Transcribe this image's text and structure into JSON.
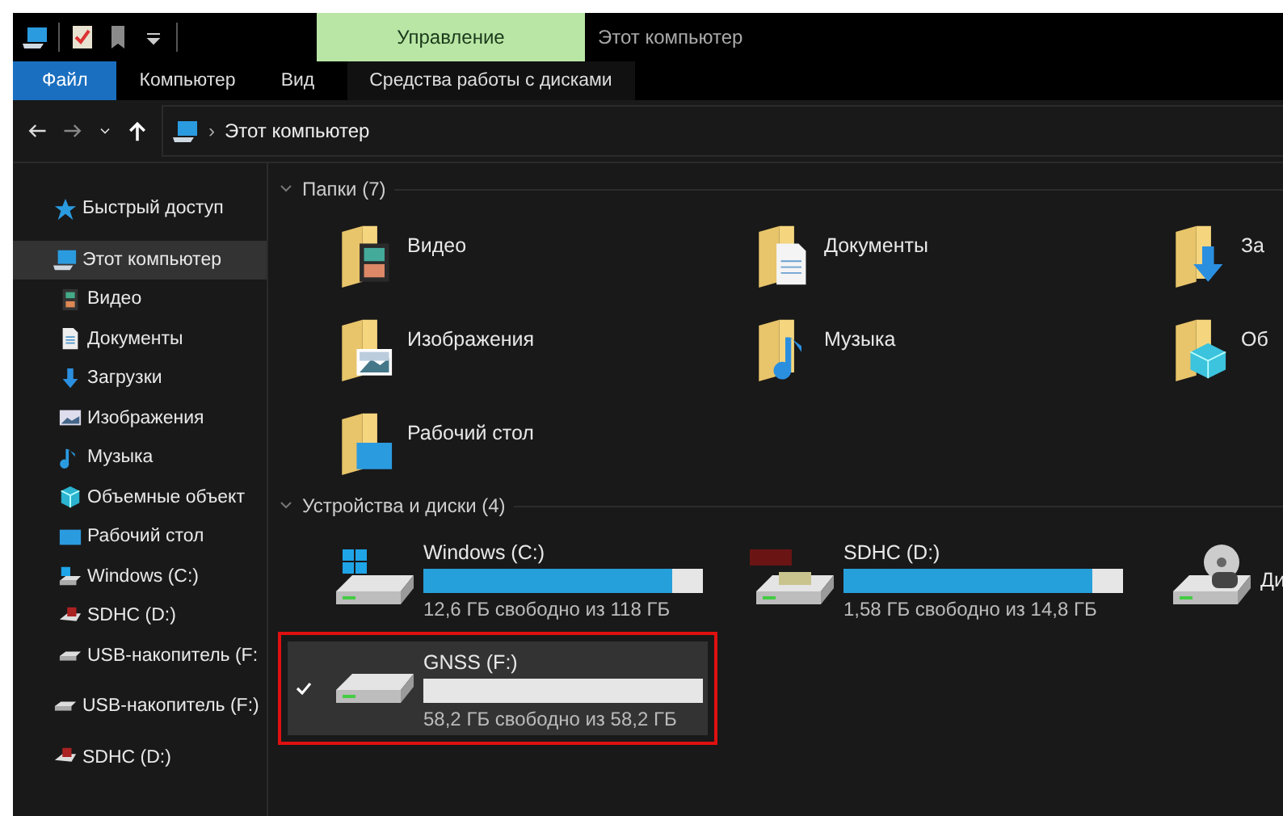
{
  "title_bar": {
    "context_tab": "Управление",
    "title": "Этот компьютер"
  },
  "ribbon_tabs": [
    {
      "label": "Файл",
      "selected": true,
      "contextual": false
    },
    {
      "label": "Компьютер",
      "selected": false,
      "contextual": false
    },
    {
      "label": "Вид",
      "selected": false,
      "contextual": false
    },
    {
      "label": "Средства работы с дисками",
      "selected": false,
      "contextual": true
    }
  ],
  "address_bar": {
    "separator": "›",
    "path": "Этот компьютер"
  },
  "sidebar": {
    "items": [
      {
        "label": "Быстрый доступ",
        "kind": "star",
        "selected": false
      },
      {
        "label": "Этот компьютер",
        "kind": "pc",
        "selected": true,
        "children": [
          {
            "label": "Видео",
            "kind": "video",
            "selected": false
          },
          {
            "label": "Документы",
            "kind": "docs",
            "selected": false
          },
          {
            "label": "Загрузки",
            "kind": "download",
            "selected": false
          },
          {
            "label": "Изображения",
            "kind": "pictures",
            "selected": false
          },
          {
            "label": "Музыка",
            "kind": "music",
            "selected": false
          },
          {
            "label": "Объемные объект",
            "kind": "cube",
            "selected": false
          },
          {
            "label": "Рабочий стол",
            "kind": "desktop",
            "selected": false
          },
          {
            "label": "Windows (C:)",
            "kind": "windows",
            "selected": false
          },
          {
            "label": "SDHC (D:)",
            "kind": "sd",
            "selected": false
          },
          {
            "label": "USB-накопитель (F:",
            "kind": "usb",
            "selected": false
          }
        ]
      },
      {
        "label": "USB-накопитель (F:)",
        "kind": "usb",
        "selected": false
      },
      {
        "label": "SDHC (D:)",
        "kind": "sd",
        "selected": false
      }
    ]
  },
  "folders": {
    "header": "Папки (7)",
    "items": [
      {
        "label": "Видео",
        "kind": "video"
      },
      {
        "label": "Документы",
        "kind": "docs"
      },
      {
        "label": "За",
        "kind": "download"
      },
      {
        "label": "Изображения",
        "kind": "pictures"
      },
      {
        "label": "Музыка",
        "kind": "music"
      },
      {
        "label": "Об",
        "kind": "cube"
      },
      {
        "label": "Рабочий стол",
        "kind": "desktop"
      }
    ]
  },
  "drives": {
    "header": "Устройства и диски (4)",
    "items": [
      {
        "label": "Windows (C:)",
        "kind": "windows",
        "level": 0.89,
        "free": "12,6 ГБ свободно из 118 ГБ",
        "selected": false,
        "checked": false,
        "highlighted": false
      },
      {
        "label": "SDHC (D:)",
        "kind": "sd",
        "level": 0.89,
        "free": "1,58 ГБ свободно из 14,8 ГБ",
        "selected": false,
        "checked": false,
        "highlighted": false
      },
      {
        "label": "Ди",
        "kind": "bd",
        "selected": false,
        "checked": false,
        "highlighted": false
      },
      {
        "label": "GNSS (F:)",
        "kind": "usb",
        "level": 0,
        "free": "58,2 ГБ свободно из 58,2 ГБ",
        "selected": true,
        "checked": true,
        "highlighted": true
      }
    ]
  }
}
